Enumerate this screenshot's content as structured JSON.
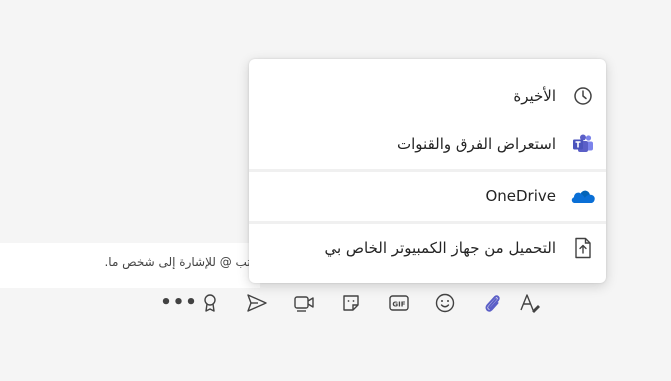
{
  "compose": {
    "placeholder": "اكتب @ للإشارة إلى شخص ما."
  },
  "attach_menu": {
    "items": [
      {
        "label": "الأخيرة",
        "icon": "clock-icon"
      },
      {
        "label": "استعراض الفرق والقنوات",
        "icon": "teams-icon"
      },
      {
        "label": "OneDrive",
        "icon": "onedrive-icon"
      },
      {
        "label": "التحميل من جهاز الكمبيوتر الخاص بي",
        "icon": "upload-icon"
      }
    ]
  },
  "toolbar": {
    "buttons": [
      {
        "name": "format-icon"
      },
      {
        "name": "attach-icon",
        "color": "#5b5fc7"
      },
      {
        "name": "emoji-icon"
      },
      {
        "name": "gif-icon",
        "text": "GIF"
      },
      {
        "name": "sticker-icon"
      },
      {
        "name": "meet-now-icon"
      },
      {
        "name": "send-schedule-icon"
      },
      {
        "name": "praise-icon"
      },
      {
        "name": "more-options-icon",
        "text": "•••"
      }
    ]
  },
  "colors": {
    "accent": "#5b5fc7",
    "onedrive": "#0a6fd6",
    "teams": "#5b5fc7"
  }
}
